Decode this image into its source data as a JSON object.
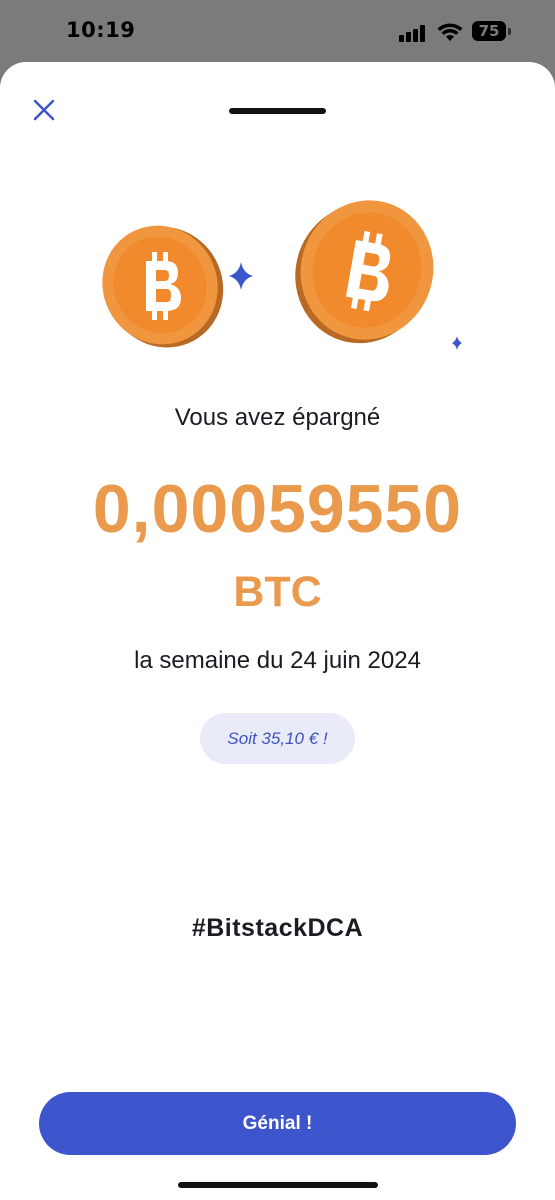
{
  "status_bar": {
    "time": "10:19",
    "battery": "75"
  },
  "modal": {
    "saved_label": "Vous avez épargné",
    "amount": "0,00059550",
    "unit": "BTC",
    "period": "la semaine du 24 juin 2024",
    "fiat_equivalent": "Soit 35,10 € !",
    "hashtag": "#BitstackDCA",
    "cta_label": "Génial !"
  },
  "colors": {
    "accent_orange": "#ea9a4c",
    "primary_blue": "#3d55cc",
    "pill_bg": "#e9ecf8"
  },
  "icons": {
    "close": "close-icon",
    "coins": "bitcoin-coin-icon",
    "sparkles": "sparkle-icon"
  }
}
